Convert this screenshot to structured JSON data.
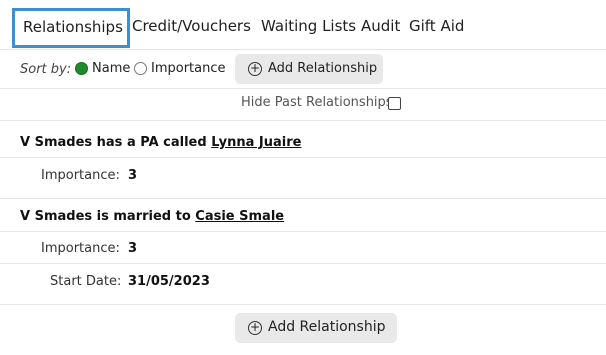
{
  "tabs": [
    {
      "label": "Relationships",
      "active": true
    },
    {
      "label": "Credit/Vouchers",
      "active": false
    },
    {
      "label": "Waiting Lists",
      "active": false
    },
    {
      "label": "Audit",
      "active": false
    },
    {
      "label": "Gift Aid",
      "active": false
    }
  ],
  "sort": {
    "label": "Sort by:",
    "options": [
      {
        "label": "Name",
        "selected": true
      },
      {
        "label": "Importance",
        "selected": false
      }
    ]
  },
  "add_button_label": "Add Relationship",
  "hide_past_label": "Hide Past Relationships",
  "relationships": [
    {
      "prefix": "V Smades has a PA called ",
      "person": "Lynna Juaire",
      "fields": [
        {
          "label": "Importance:",
          "value": "3"
        }
      ]
    },
    {
      "prefix": "V Smades is married to ",
      "person": "Casie Smale",
      "fields": [
        {
          "label": "Importance:",
          "value": "3"
        },
        {
          "label": "Start Date:",
          "value": "31/05/2023"
        }
      ]
    }
  ],
  "colors": {
    "active_tab_border": "#3d8fd0",
    "radio_selected": "#1e8a2a",
    "button_bg": "#e9e9e9"
  },
  "icons": [
    "plus-circle-icon"
  ]
}
